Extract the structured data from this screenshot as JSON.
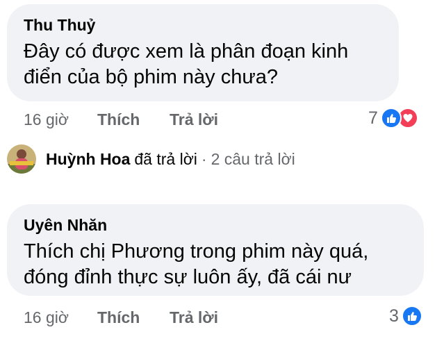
{
  "comments": [
    {
      "author": "Thu Thuỷ",
      "line1": "Đây có được xem là phân đoạn kinh",
      "line2": "điển của bộ phim này chưa?",
      "time": "16 giờ",
      "like_label": "Thích",
      "reply_label": "Trả lời",
      "reaction_count": "7",
      "reactions": [
        "like-icon",
        "love-icon"
      ]
    },
    {
      "author": "Uyên Nhăn",
      "line1": "Thích chị Phương trong phim này quá,",
      "line2": "đóng đỉnh thực sự luôn ấy, đã cái nư",
      "time": "16 giờ",
      "like_label": "Thích",
      "reply_label": "Trả lời",
      "reaction_count": "3",
      "reactions": [
        "like-icon"
      ]
    }
  ],
  "reply_summary": {
    "name": "Huỳnh Hoa",
    "action": "đã trả lời",
    "separator": "·",
    "count": "2 câu trả lời"
  },
  "colors": {
    "bubble": "#f0f2f5",
    "secondary_text": "#65676b",
    "like_blue": "#1877f2",
    "love_red": "#f33e58"
  }
}
